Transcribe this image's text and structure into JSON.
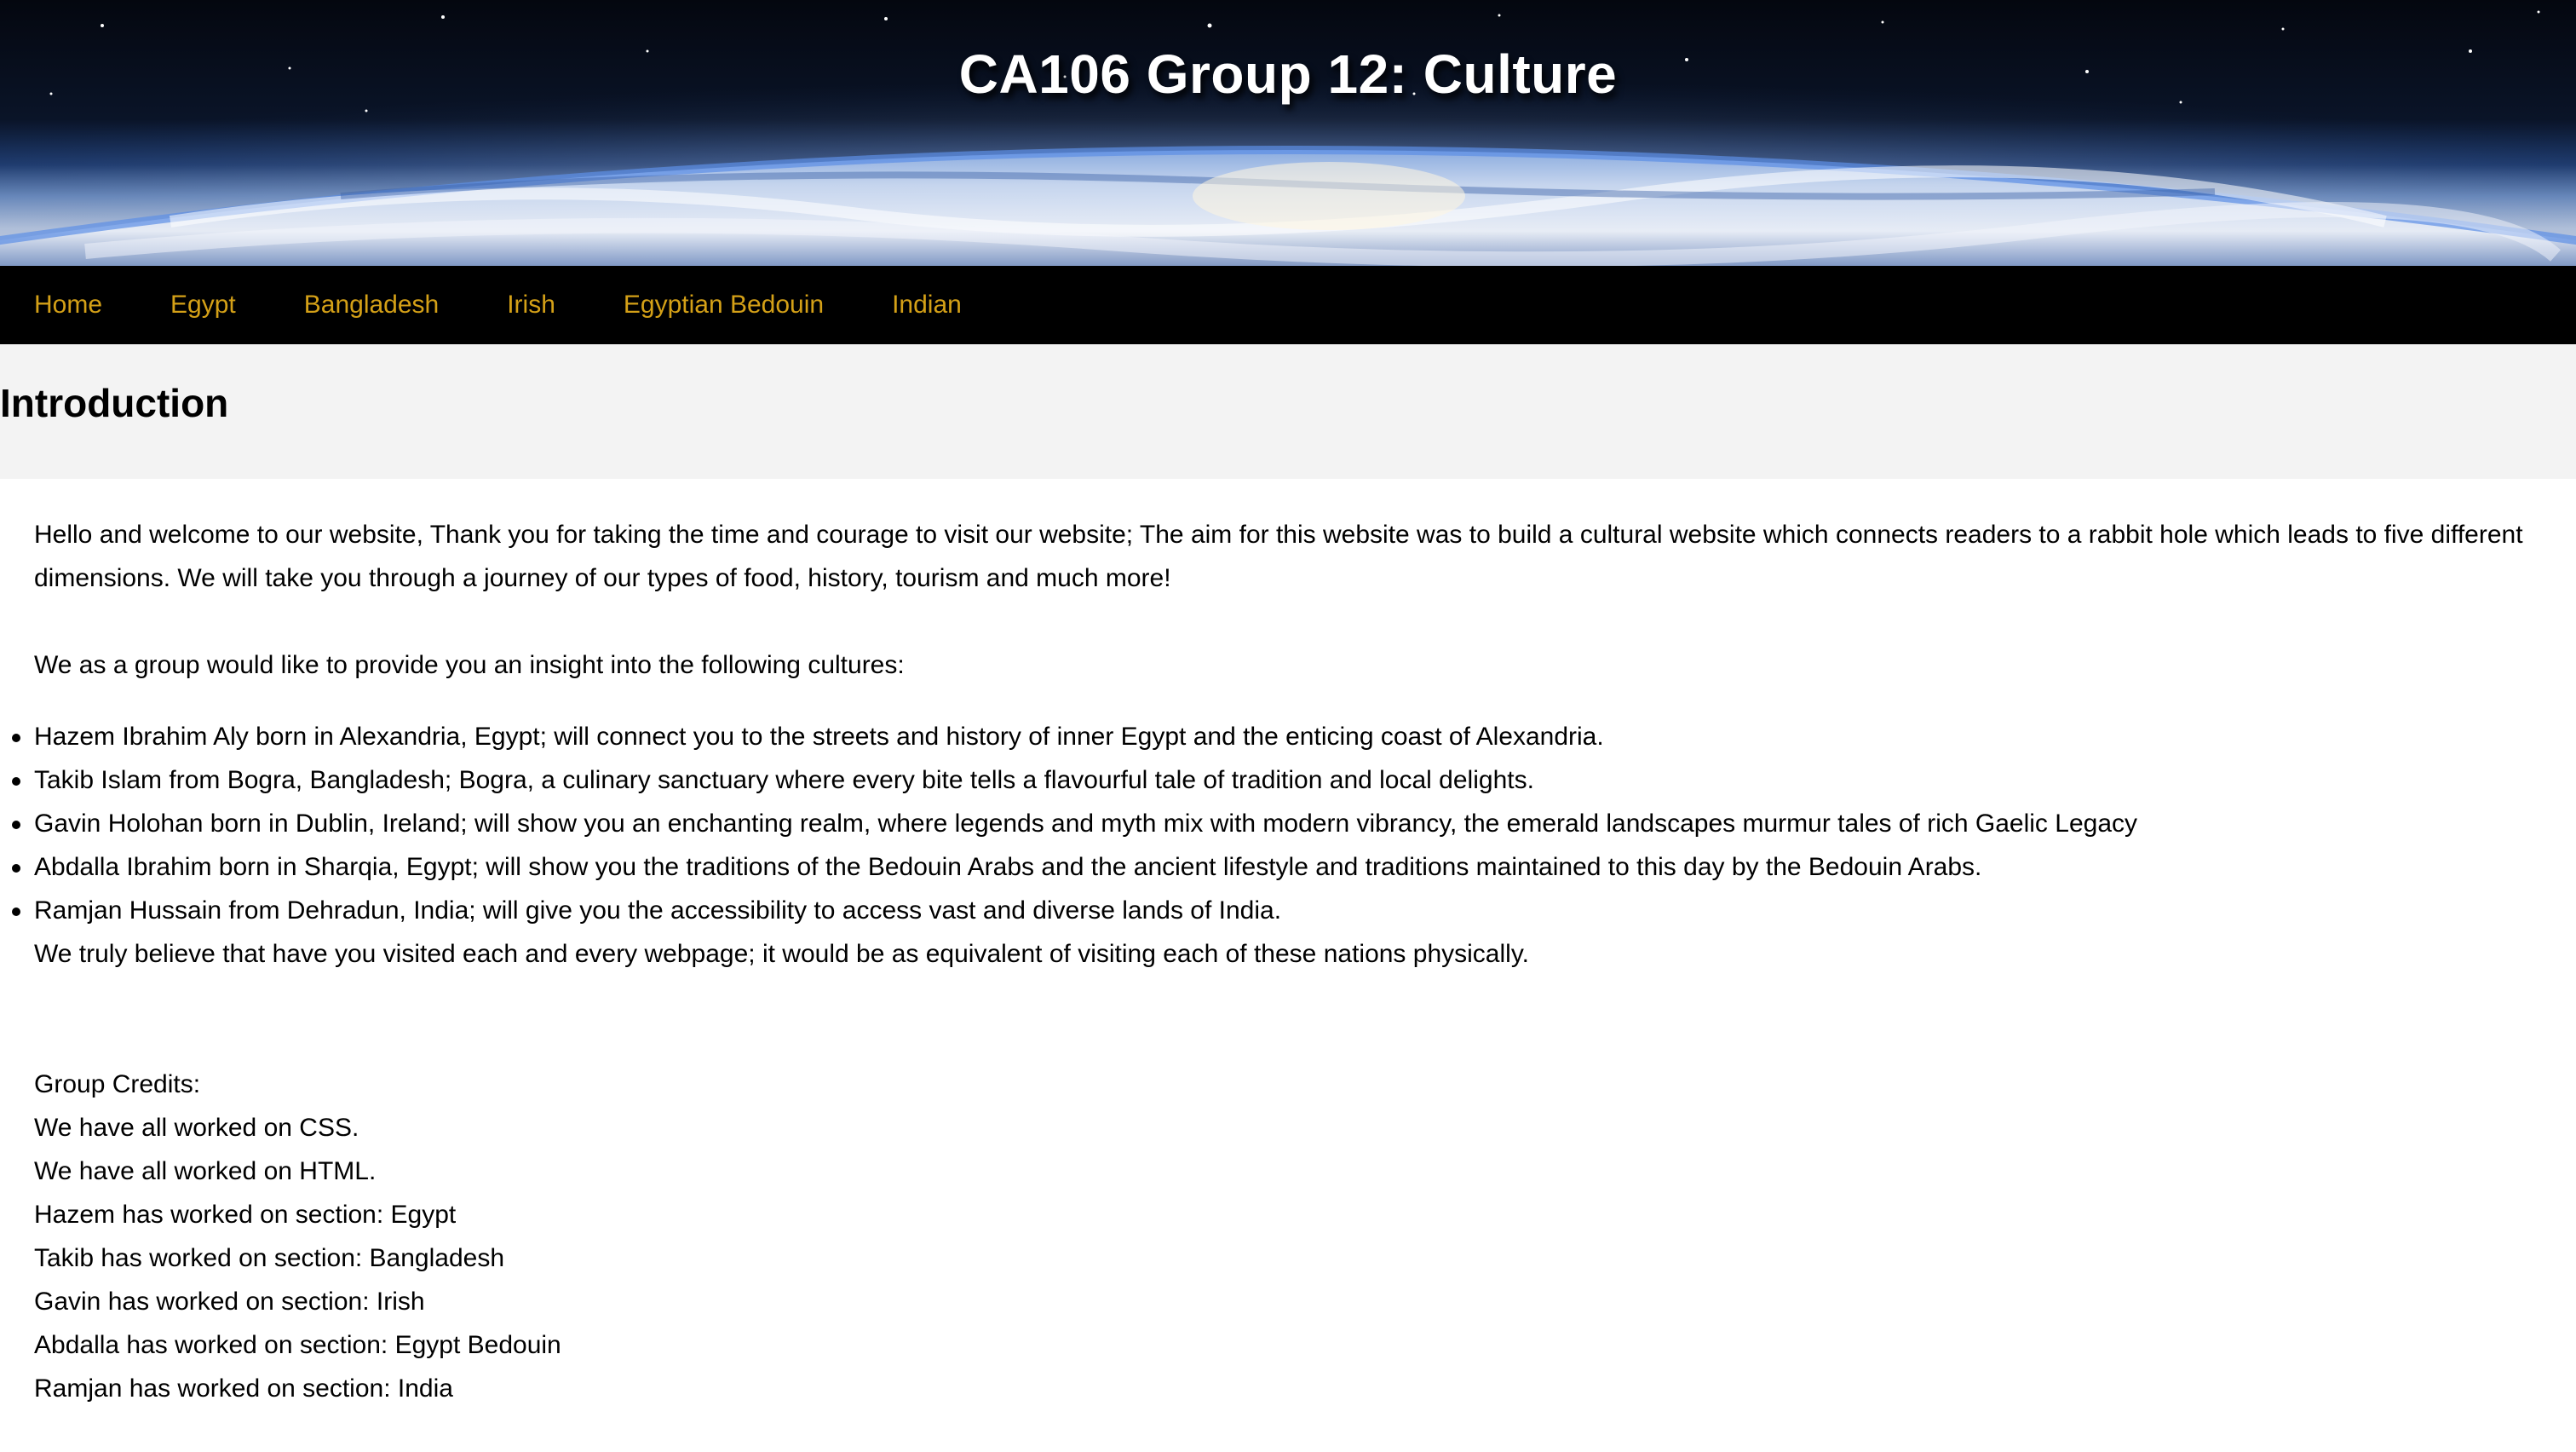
{
  "header": {
    "title": "CA106 Group 12: Culture"
  },
  "nav": {
    "items": [
      {
        "label": "Home"
      },
      {
        "label": "Egypt"
      },
      {
        "label": "Bangladesh"
      },
      {
        "label": "Irish"
      },
      {
        "label": "Egyptian Bedouin"
      },
      {
        "label": "Indian"
      }
    ],
    "link_color": "#d4a017"
  },
  "intro": {
    "heading": "Introduction"
  },
  "content": {
    "welcome": "Hello and welcome to our website, Thank you for taking the time and courage to visit our website; The aim for this website was to build a cultural website which connects readers to a rabbit hole which leads to five different dimensions. We will take you through a journey of our types of food, history, tourism and much more!",
    "group_intro": "We as a group would like to provide you an insight into the following cultures:",
    "cultures": [
      "Hazem Ibrahim Aly born in Alexandria, Egypt; will connect you to the streets and history of inner Egypt and the enticing coast of Alexandria.",
      "Takib Islam from Bogra, Bangladesh; Bogra, a culinary sanctuary where every bite tells a flavourful tale of tradition and local delights.",
      "Gavin Holohan born in Dublin, Ireland; will show you an enchanting realm, where legends and myth mix with modern vibrancy, the emerald landscapes murmur tales of rich Gaelic Legacy",
      "Abdalla Ibrahim born in Sharqia, Egypt; will show you the traditions of the Bedouin Arabs and the ancient lifestyle and traditions maintained to this day by the Bedouin Arabs.",
      "Ramjan Hussain from Dehradun, India; will give you the accessibility to access vast and diverse lands of India."
    ],
    "closing": "We truly believe that have you visited each and every webpage; it would be as equivalent of visiting each of these nations physically.",
    "credits": [
      "Group Credits:",
      "We have all worked on CSS.",
      "We have all worked on HTML.",
      "Hazem has worked on section: Egypt",
      "Takib has worked on section: Bangladesh",
      "Gavin has worked on section: Irish",
      "Abdalla has worked on section: Egypt Bedouin",
      "Ramjan has worked on section: India"
    ]
  }
}
